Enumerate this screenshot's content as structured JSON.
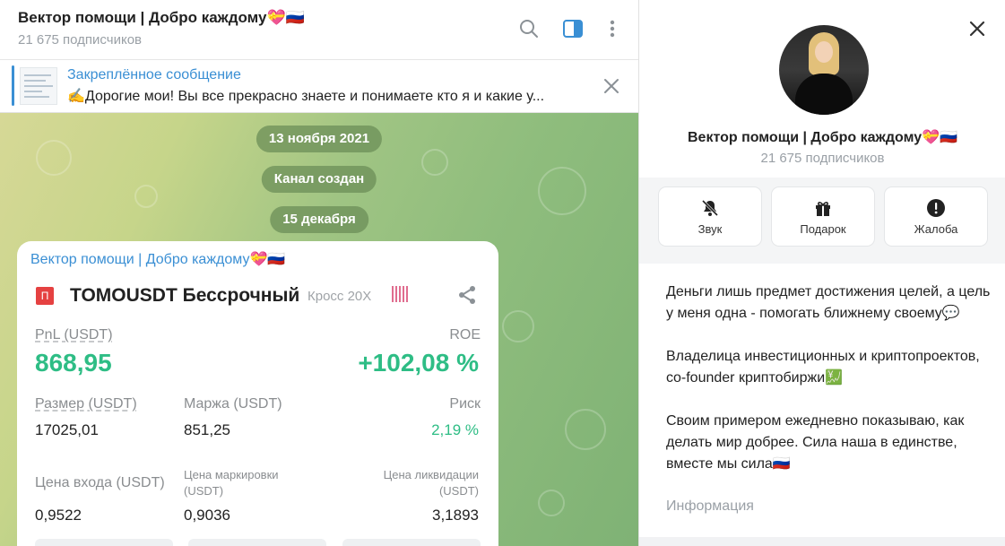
{
  "header": {
    "title": "Вектор помощи | Добро каждому💝🇷🇺",
    "subscribers": "21 675 подписчиков",
    "icons": [
      "search-icon",
      "sidebar-toggle-icon",
      "more-vertical-icon"
    ]
  },
  "pinned": {
    "title": "Закреплённое сообщение",
    "text": "✍️Дорогие мои! Вы все прекрасно знаете и понимаете кто я и какие у..."
  },
  "chat": {
    "date_1": "13 ноября 2021",
    "service_1": "Канал создан",
    "date_2": "15 декабря"
  },
  "message": {
    "author": "Вектор помощи | Добро каждому💝🇷🇺",
    "pair_icon": "П",
    "pair": "TOMOUSDT Бессрочный",
    "mode": "Кросс 20X",
    "pnl_label": "PnL (USDT)",
    "pnl_value": "868,95",
    "roe_label": "ROE",
    "roe_value": "+102,08 %",
    "size_label": "Размер (USDT)",
    "size_value": "17025,01",
    "margin_label": "Маржа (USDT)",
    "margin_value": "851,25",
    "risk_label": "Риск",
    "risk_value": "2,19 %",
    "entry_label": "Цена входа (USDT)",
    "entry_value": "0,9522",
    "mark_label": "Цена маркировки (USDT)",
    "mark_value": "0,9036",
    "liq_label": "Цена ликвидации (USDT)",
    "liq_value": "3,1893"
  },
  "panel": {
    "name": "Вектор помощи | Добро каждому💝🇷🇺",
    "subscribers": "21 675 подписчиков",
    "actions": [
      {
        "label": "Звук",
        "icon": "bell-off-icon"
      },
      {
        "label": "Подарок",
        "icon": "gift-icon"
      },
      {
        "label": "Жалоба",
        "icon": "alert-icon"
      }
    ],
    "about_1": "Деньги лишь предмет достижения целей, а цель у меня одна - помогать ближнему своему💬",
    "about_2": "Владелица инвестиционных и криптопроектов, co-founder криптобиржи💹",
    "about_3": "Своим примером ежедневно показываю, как делать мир добрее. Сила наша в единстве, вместе мы сила🇷🇺",
    "info_label": "Информация"
  },
  "colors": {
    "accent": "#3a8fd4",
    "positive": "#2ebd85",
    "danger": "#e54141"
  }
}
